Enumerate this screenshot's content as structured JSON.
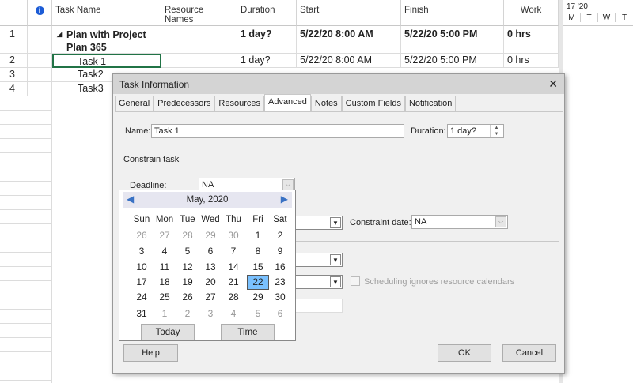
{
  "grid": {
    "headers": {
      "info": "i",
      "task_name": "Task Name",
      "resources": "Resource Names",
      "duration": "Duration",
      "start": "Start",
      "finish": "Finish",
      "work": "Work"
    },
    "rows": [
      {
        "id": "1",
        "name": "Plan with Project Plan 365",
        "duration": "1 day?",
        "start": "5/22/20 8:00 AM",
        "finish": "5/22/20 5:00 PM",
        "work": "0 hrs"
      },
      {
        "id": "2",
        "name": "Task 1",
        "duration": "1 day?",
        "start": "5/22/20 8:00 AM",
        "finish": "5/22/20 5:00 PM",
        "work": "0 hrs"
      },
      {
        "id": "3",
        "name": "Task2"
      },
      {
        "id": "4",
        "name": "Task3"
      }
    ]
  },
  "gantt": {
    "week": "17 '20",
    "days": [
      "M",
      "T",
      "W",
      "T"
    ]
  },
  "dialog": {
    "title": "Task Information",
    "close": "✕",
    "tabs": [
      "General",
      "Predecessors",
      "Resources",
      "Advanced",
      "Notes",
      "Custom Fields",
      "Notification"
    ],
    "name_label": "Name:",
    "name_value": "Task 1",
    "duration_label": "Duration:",
    "duration_value": "1 day?",
    "constrain_label": "Constrain task",
    "deadline_label": "Deadline:",
    "deadline_value": "NA",
    "constraint_date_label": "Constraint date:",
    "constraint_date_value": "NA",
    "ignore_calendars_label": "Scheduling ignores resource calendars",
    "help": "Help",
    "ok": "OK",
    "cancel": "Cancel"
  },
  "calendar": {
    "month": "May, 2020",
    "weekdays": [
      "Sun",
      "Mon",
      "Tue",
      "Wed",
      "Thu",
      "Fri",
      "Sat"
    ],
    "weeks": [
      [
        "26",
        "27",
        "28",
        "29",
        "30",
        "1",
        "2"
      ],
      [
        "3",
        "4",
        "5",
        "6",
        "7",
        "8",
        "9"
      ],
      [
        "10",
        "11",
        "12",
        "13",
        "14",
        "15",
        "16"
      ],
      [
        "17",
        "18",
        "19",
        "20",
        "21",
        "22",
        "23"
      ],
      [
        "24",
        "25",
        "26",
        "27",
        "28",
        "29",
        "30"
      ],
      [
        "31",
        "1",
        "2",
        "3",
        "4",
        "5",
        "6"
      ]
    ],
    "selected": "22",
    "today_label": "Today",
    "time_label": "Time"
  }
}
